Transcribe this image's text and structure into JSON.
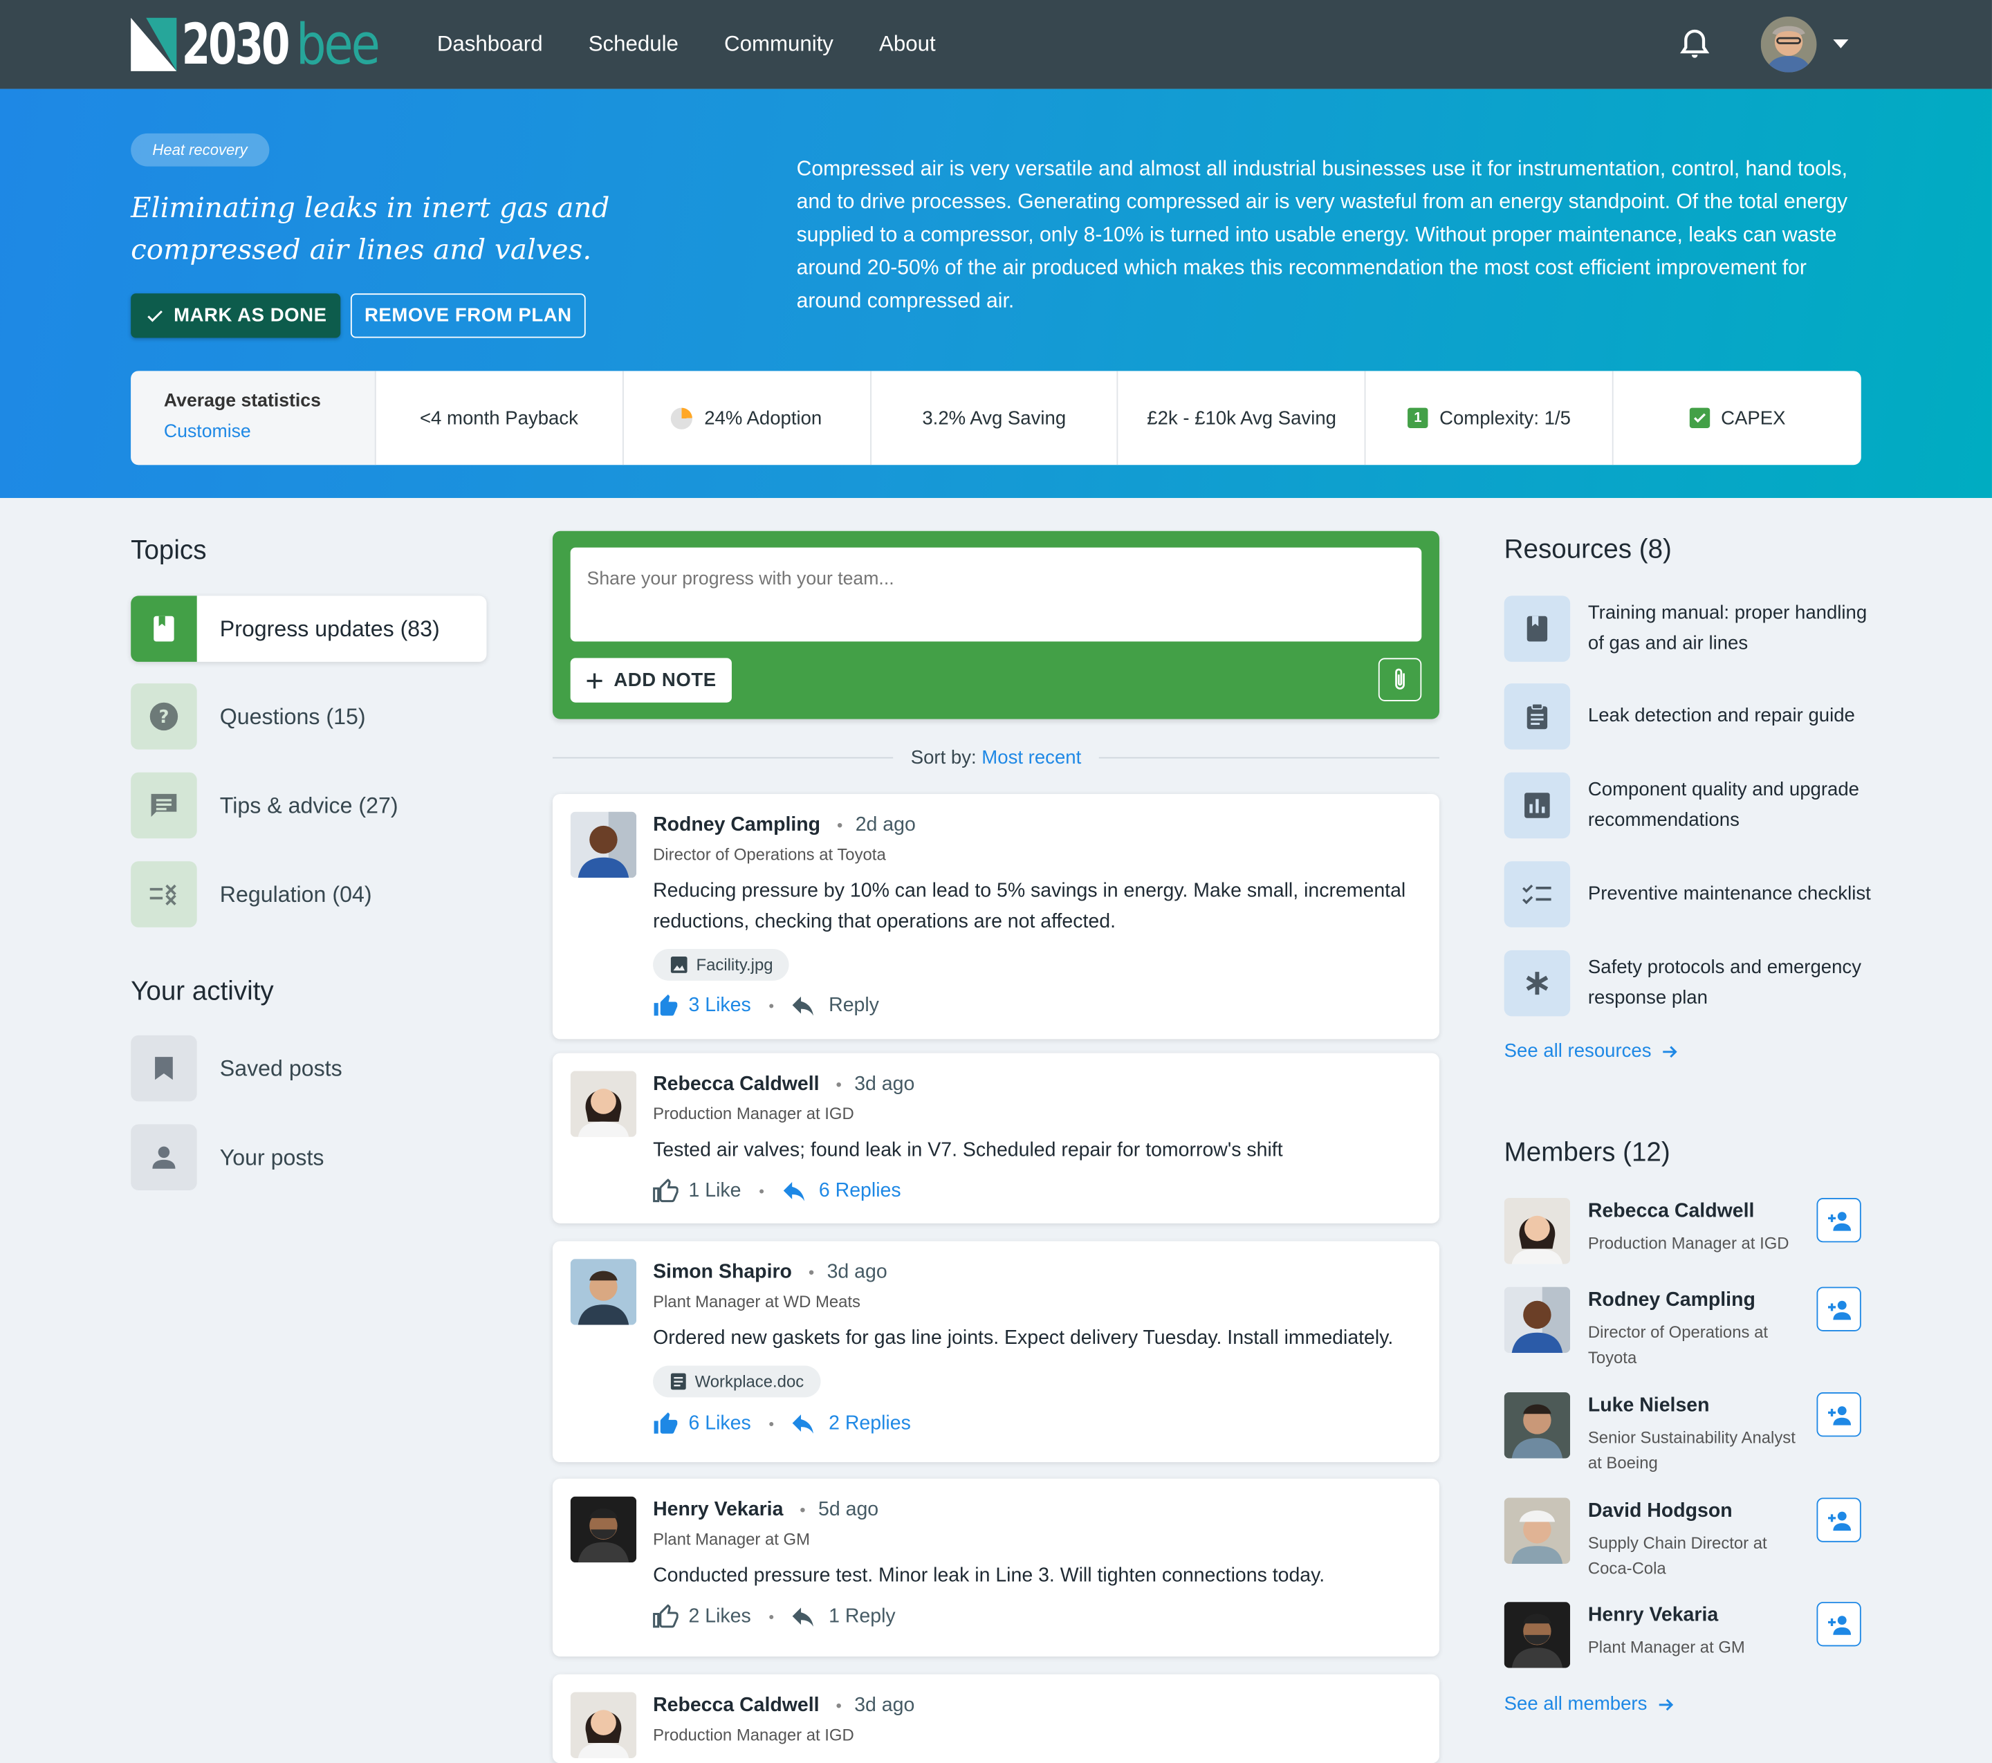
{
  "brand": {
    "number": "2030",
    "word": "bee"
  },
  "nav": {
    "links": [
      "Dashboard",
      "Schedule",
      "Community",
      "About"
    ]
  },
  "hero": {
    "chip": "Heat recovery",
    "title": "Eliminating leaks in inert gas and compressed air lines and valves.",
    "mark_done": "MARK AS DONE",
    "remove": "REMOVE FROM PLAN",
    "description": "Compressed air is very versatile and almost all industrial businesses use it for instrumentation, control, hand tools, and to drive processes. Generating compressed air is very wasteful from an energy standpoint. Of the total energy supplied to a compressor, only 8-10% is turned into usable energy. Without proper maintenance, leaks can waste around 20-50% of the air produced which makes this recommendation the most cost efficient improvement for around compressed air."
  },
  "stats": {
    "title": "Average statistics",
    "customise": "Customise",
    "payback": "<4 month Payback",
    "adoption": "24% Adoption",
    "adoption_value": 24,
    "avg_saving_pct": "3.2% Avg Saving",
    "avg_saving_money": "£2k - £10k Avg Saving",
    "complexity_badge": "1",
    "complexity": "Complexity: 1/5",
    "capex": "CAPEX",
    "accent": "#43a047"
  },
  "topics": {
    "heading": "Topics",
    "items": [
      "Progress updates (83)",
      "Questions (15)",
      "Tips & advice (27)",
      "Regulation (04)"
    ]
  },
  "activity": {
    "heading": "Your activity",
    "items": [
      "Saved posts",
      "Your posts"
    ]
  },
  "composer": {
    "placeholder": "Share your progress with your team...",
    "add_note": "ADD NOTE"
  },
  "sort": {
    "label": "Sort by:",
    "value": "Most recent"
  },
  "posts": [
    {
      "name": "Rodney Campling",
      "ago": "2d ago",
      "role": "Director of Operations at Toyota",
      "text": "Reducing pressure by 10% can lead to 5% savings in energy. Make small, incremental reductions, checking that operations are not affected.",
      "file": "Facility.jpg",
      "likes": "3 Likes",
      "replies": "Reply"
    },
    {
      "name": "Rebecca Caldwell",
      "ago": "3d ago",
      "role": "Production Manager at IGD",
      "text": "Tested air valves; found leak in V7. Scheduled repair for tomorrow's shift",
      "likes": "1 Like",
      "replies": "6 Replies"
    },
    {
      "name": "Simon Shapiro",
      "ago": "3d ago",
      "role": "Plant Manager at WD Meats",
      "text": "Ordered new gaskets for gas line joints. Expect delivery Tuesday. Install immediately.",
      "file": "Workplace.doc",
      "likes": "6 Likes",
      "replies": "2 Replies"
    },
    {
      "name": "Henry Vekaria",
      "ago": "5d ago",
      "role": "Plant Manager at GM",
      "text": "Conducted pressure test. Minor leak in Line 3. Will tighten connections today.",
      "likes": "2 Likes",
      "replies": "1 Reply"
    },
    {
      "name": "Rebecca Caldwell",
      "ago": "3d ago",
      "role": "Production Manager at IGD"
    }
  ],
  "resources": {
    "heading": "Resources (8)",
    "items": [
      "Training manual: proper handling of gas and air lines",
      "Leak detection and repair guide",
      "Component quality and upgrade recommendations",
      "Preventive maintenance checklist",
      "Safety protocols and emergency response plan"
    ],
    "see_all": "See all resources"
  },
  "members": {
    "heading": "Members (12)",
    "items": [
      {
        "name": "Rebecca Caldwell",
        "role": "Production Manager at IGD"
      },
      {
        "name": "Rodney Campling",
        "role": "Director of Operations at Toyota"
      },
      {
        "name": "Luke Nielsen",
        "role": "Senior Sustainability Analyst at Boeing"
      },
      {
        "name": "David Hodgson",
        "role": "Supply Chain Director at Coca-Cola"
      },
      {
        "name": "Henry Vekaria",
        "role": "Plant Manager at GM"
      }
    ],
    "see_all": "See all members"
  },
  "icons": {
    "bell": "bell-icon",
    "paperclip": "paperclip-icon",
    "thumb": "thumb-up-icon",
    "reply": "reply-icon",
    "plus": "plus-icon",
    "check": "check-icon",
    "arrow": "arrow-right-icon",
    "add_member": "person-add-icon"
  }
}
